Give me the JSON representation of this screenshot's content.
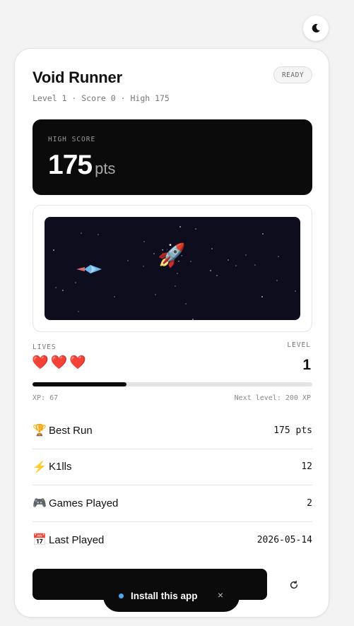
{
  "theme_toggle": {
    "icon": "moon-icon"
  },
  "header": {
    "title": "Void Runner",
    "status_badge": "READY",
    "subline": "Level 1 · Score 0 · High 175"
  },
  "high_score": {
    "label": "HIGH SCORE",
    "value": "175",
    "unit": "pts"
  },
  "game": {
    "player_icon": "rocket-icon",
    "enemy_icon": "arrow-ship-icon",
    "canvas_color": "#0d0d1e"
  },
  "lives": {
    "label": "LIVES",
    "count": 3,
    "icon": "heart-icon",
    "hearts": [
      "❤️",
      "❤️",
      "❤️"
    ]
  },
  "level": {
    "label": "LEVEL",
    "value": "1"
  },
  "xp": {
    "label": "XP: 67",
    "next": "Next level: 200 XP",
    "current": 67,
    "target": 200
  },
  "stats": [
    {
      "emoji": "🏆",
      "label": "Best Run",
      "value": "175 pts"
    },
    {
      "emoji": "⚡",
      "label": "K1lls",
      "value": "12"
    },
    {
      "emoji": "🎮",
      "label": "Games Played",
      "value": "2"
    },
    {
      "emoji": "📅",
      "label": "Last Played",
      "value": "2026-05-14"
    }
  ],
  "actions": {
    "reset_icon": "restart-icon"
  },
  "install_toast": {
    "text": "Install this app",
    "close": "×"
  }
}
